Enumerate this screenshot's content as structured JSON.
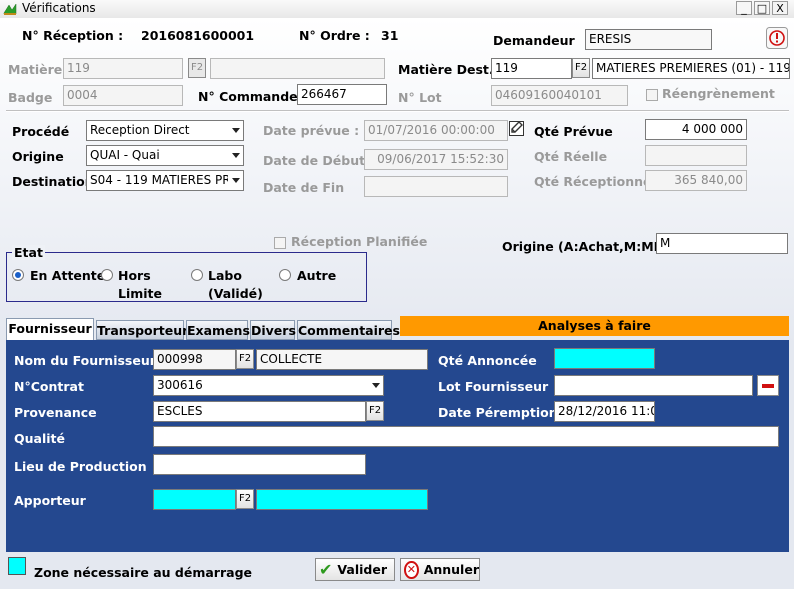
{
  "window": {
    "title": "Vérifications",
    "minimize": "_",
    "maximize": "□",
    "close": "X"
  },
  "header": {
    "reception_label": "N° Réception :",
    "reception_value": "2016081600001",
    "ordre_label": "N° Ordre :",
    "ordre_value": "31",
    "demandeur_label": "Demandeur",
    "demandeur_value": "ERESIS"
  },
  "row_matiere": {
    "matiere_label": "Matière",
    "matiere_code": "119",
    "matiere_f2": "F2",
    "matiere_name": "",
    "dest_label": "Matière Dest.",
    "dest_code": "119",
    "dest_f2": "F2",
    "dest_name": "MATIERES PREMIERES (01) - 119"
  },
  "row_badge": {
    "badge_label": "Badge",
    "badge_value": "0004",
    "commande_label": "N° Commande",
    "commande_value": "266467",
    "lot_label": "N° Lot",
    "lot_value": "04609160040101",
    "reengrenement_label": "Réengrènement"
  },
  "procede": {
    "procede_label": "Procédé",
    "procede_value": "Reception Direct",
    "origine_label": "Origine",
    "origine_value": "QUAI - Quai",
    "destination_label": "Destination",
    "destination_value": "S04 - 119 MATIERES PRE"
  },
  "dates": {
    "prevue_label": "Date prévue :",
    "prevue_value": "01/07/2016 00:00:00",
    "debut_label": "Date de Début",
    "debut_value": "09/06/2017 15:52:30",
    "fin_label": "Date de Fin",
    "fin_value": ""
  },
  "quantites": {
    "prevue_label": "Qté Prévue",
    "prevue_value": "4 000 000",
    "reelle_label": "Qté Réelle",
    "reelle_value": "",
    "receptionnee_label": "Qté Réceptionnée",
    "receptionnee_value": "365 840,00"
  },
  "reception_planifiee_label": "Réception Planifiée",
  "origine_achat": {
    "label": "Origine (A:Achat,M:MP)",
    "value": "M"
  },
  "etat": {
    "legend": "Etat",
    "options": [
      "En Attente",
      "Hors",
      "Limite",
      "Labo",
      "(Validé)",
      "Autre"
    ],
    "selected": "En Attente"
  },
  "tabs": [
    "Fournisseur",
    "Transporteur",
    "Examens",
    "Divers",
    "Commentaires"
  ],
  "analyses_label": "Analyses à faire",
  "fournisseur": {
    "nom_label": "Nom du Fournisseur",
    "nom_code": "000998",
    "nom_f2": "F2",
    "nom_value": "COLLECTE",
    "contrat_label": "N°Contrat",
    "contrat_value": "300616",
    "provenance_label": "Provenance",
    "provenance_value": "ESCLES",
    "provenance_f2": "F2",
    "qualite_label": "Qualité",
    "qualite_value": "",
    "lieu_label": "Lieu de Production",
    "lieu_value": "",
    "apporteur_label": "Apporteur",
    "apporteur_code": "",
    "apporteur_f2": "F2",
    "apporteur_value": "",
    "qte_annoncee_label": "Qté Annoncée",
    "qte_annoncee_value": "",
    "lot_fournisseur_label": "Lot Fournisseur",
    "lot_fournisseur_value": "",
    "date_peremption_label": "Date Péremption",
    "date_peremption_value": "28/12/2016 11:0"
  },
  "footer": {
    "legend_label": "Zone nécessaire au démarrage",
    "valider_label": "Valider",
    "annuler_label": "Annuler"
  },
  "colors": {
    "required_zone": "#00ffff",
    "panel_bg": "#24488f",
    "analyses_bg": "#ff9900",
    "etat_border": "#2b2b8c"
  }
}
